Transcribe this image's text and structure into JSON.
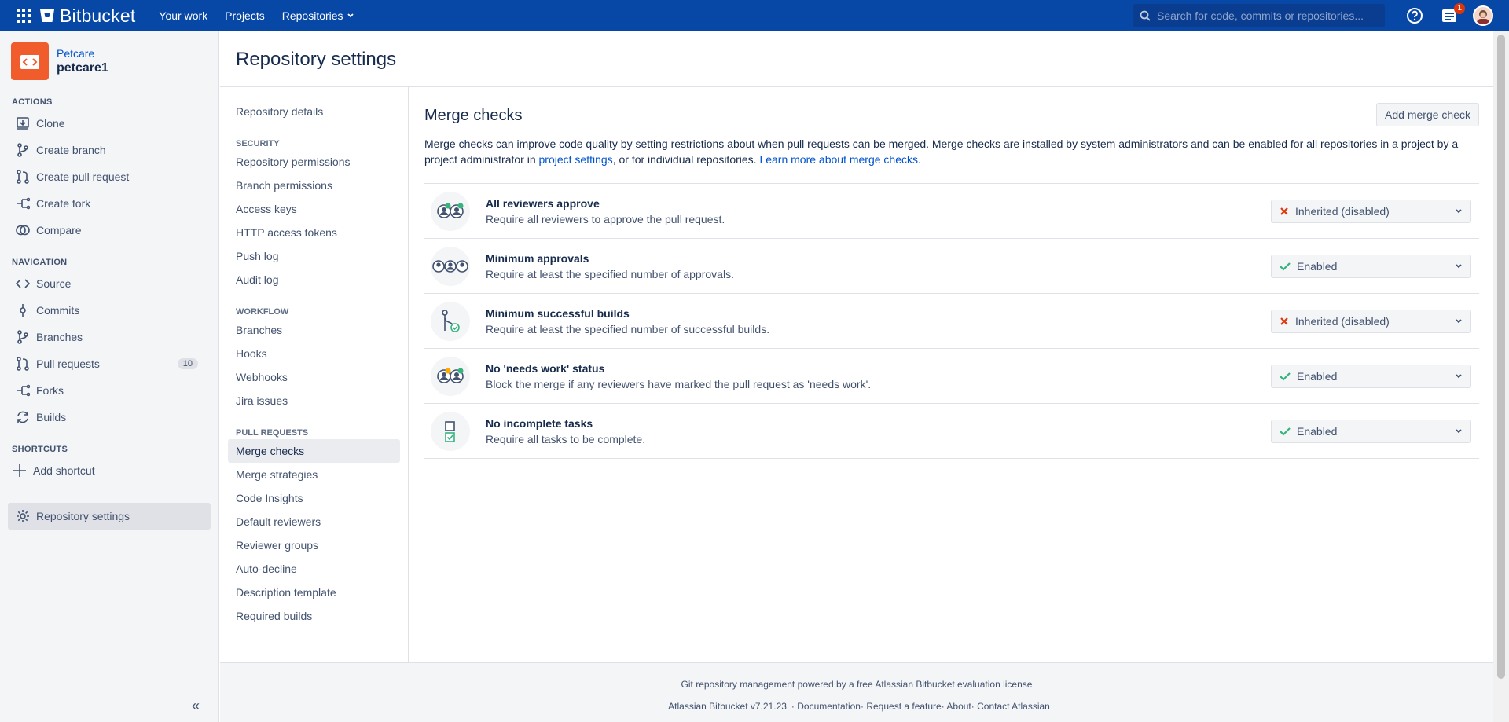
{
  "topbar": {
    "brand": "Bitbucket",
    "nav": [
      "Your work",
      "Projects",
      "Repositories"
    ],
    "search_placeholder": "Search for code, commits or repositories...",
    "notification_count": "1",
    "colors": {
      "bar": "#0747a6"
    }
  },
  "repo": {
    "project": "Petcare",
    "name": "petcare1",
    "color": "#f05c2c"
  },
  "sidebar": {
    "actions_label": "ACTIONS",
    "actions": [
      {
        "label": "Clone",
        "icon": "clone-icon"
      },
      {
        "label": "Create branch",
        "icon": "branch-icon"
      },
      {
        "label": "Create pull request",
        "icon": "pull-request-icon"
      },
      {
        "label": "Create fork",
        "icon": "fork-icon"
      },
      {
        "label": "Compare",
        "icon": "compare-icon"
      }
    ],
    "navigation_label": "NAVIGATION",
    "navigation": [
      {
        "label": "Source",
        "icon": "source-icon"
      },
      {
        "label": "Commits",
        "icon": "commit-icon"
      },
      {
        "label": "Branches",
        "icon": "branch-icon"
      },
      {
        "label": "Pull requests",
        "icon": "pull-request-icon",
        "count": "10"
      },
      {
        "label": "Forks",
        "icon": "fork-icon"
      },
      {
        "label": "Builds",
        "icon": "builds-icon"
      }
    ],
    "shortcuts_label": "SHORTCUTS",
    "add_shortcut": "Add shortcut",
    "settings": "Repository settings"
  },
  "page": {
    "title": "Repository settings"
  },
  "settings_nav": {
    "repository_details": "Repository details",
    "security_label": "SECURITY",
    "security": [
      "Repository permissions",
      "Branch permissions",
      "Access keys",
      "HTTP access tokens",
      "Push log",
      "Audit log"
    ],
    "workflow_label": "WORKFLOW",
    "workflow": [
      "Branches",
      "Hooks",
      "Webhooks",
      "Jira issues"
    ],
    "pull_requests_label": "PULL REQUESTS",
    "pull_requests": [
      "Merge checks",
      "Merge strategies",
      "Code Insights",
      "Default reviewers",
      "Reviewer groups",
      "Auto-decline",
      "Description template",
      "Required builds"
    ]
  },
  "merge_checks": {
    "title": "Merge checks",
    "add_button": "Add merge check",
    "desc_part1": "Merge checks can improve code quality by setting restrictions about when pull requests can be merged. Merge checks are installed by system administrators and can be enabled for all repositories in a project by a project administrator in ",
    "desc_link1": "project settings",
    "desc_part2": ", or for individual repositories. ",
    "desc_link2": "Learn more about merge checks",
    "desc_part3": ".",
    "checks": [
      {
        "name": "All reviewers approve",
        "description": "Require all reviewers to approve the pull request.",
        "status": "Inherited (disabled)",
        "state": "disabled"
      },
      {
        "name": "Minimum approvals",
        "description": "Require at least the specified number of approvals.",
        "status": "Enabled",
        "state": "enabled"
      },
      {
        "name": "Minimum successful builds",
        "description": "Require at least the specified number of successful builds.",
        "status": "Inherited (disabled)",
        "state": "disabled"
      },
      {
        "name": "No 'needs work' status",
        "description": "Block the merge if any reviewers have marked the pull request as 'needs work'.",
        "status": "Enabled",
        "state": "enabled"
      },
      {
        "name": "No incomplete tasks",
        "description": "Require all tasks to be complete.",
        "status": "Enabled",
        "state": "enabled"
      }
    ]
  },
  "footer": {
    "line1": "Git repository management powered by a free Atlassian Bitbucket evaluation license",
    "links": [
      "Atlassian Bitbucket v7.21.23",
      "Documentation",
      "Request a feature",
      "About",
      "Contact Atlassian"
    ]
  }
}
